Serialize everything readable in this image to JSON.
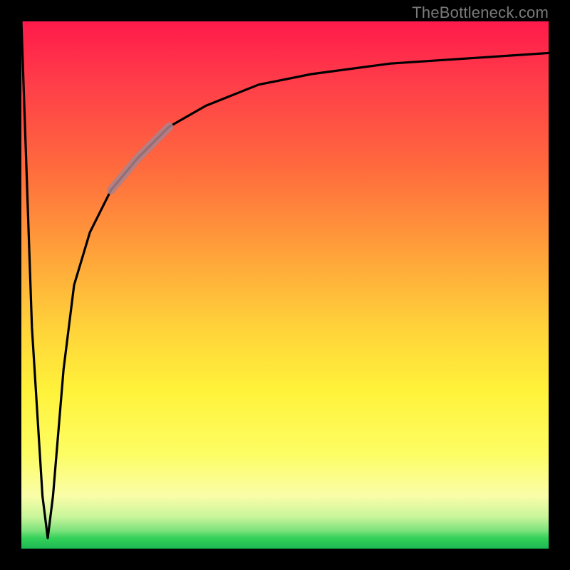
{
  "watermark": "TheBottleneck.com",
  "colors": {
    "frame": "#000000",
    "watermark": "#7a7a7a",
    "curve": "#000000",
    "highlight": "rgba(170,130,140,0.85)",
    "gradient_stops": [
      "#ff1a4b",
      "#ff6b3d",
      "#ffd23a",
      "#fff23a",
      "#fafda8",
      "#34d159",
      "#1db954"
    ]
  },
  "chart_data": {
    "type": "line",
    "title": "",
    "xlabel": "",
    "ylabel": "",
    "xlim": [
      0,
      100
    ],
    "ylim": [
      0,
      100
    ],
    "grid": false,
    "legend": false,
    "series": [
      {
        "name": "bottleneck-curve",
        "x": [
          0,
          2,
          4,
          5,
          6,
          8,
          10,
          13,
          17,
          22,
          28,
          35,
          45,
          55,
          70,
          85,
          100
        ],
        "y": [
          100,
          42,
          10,
          2,
          10,
          34,
          50,
          60,
          68,
          74,
          80,
          84,
          88,
          90,
          92,
          93,
          94
        ]
      }
    ],
    "highlight_segment": {
      "series": "bottleneck-curve",
      "x_start": 17,
      "x_end": 28
    },
    "annotations": []
  }
}
